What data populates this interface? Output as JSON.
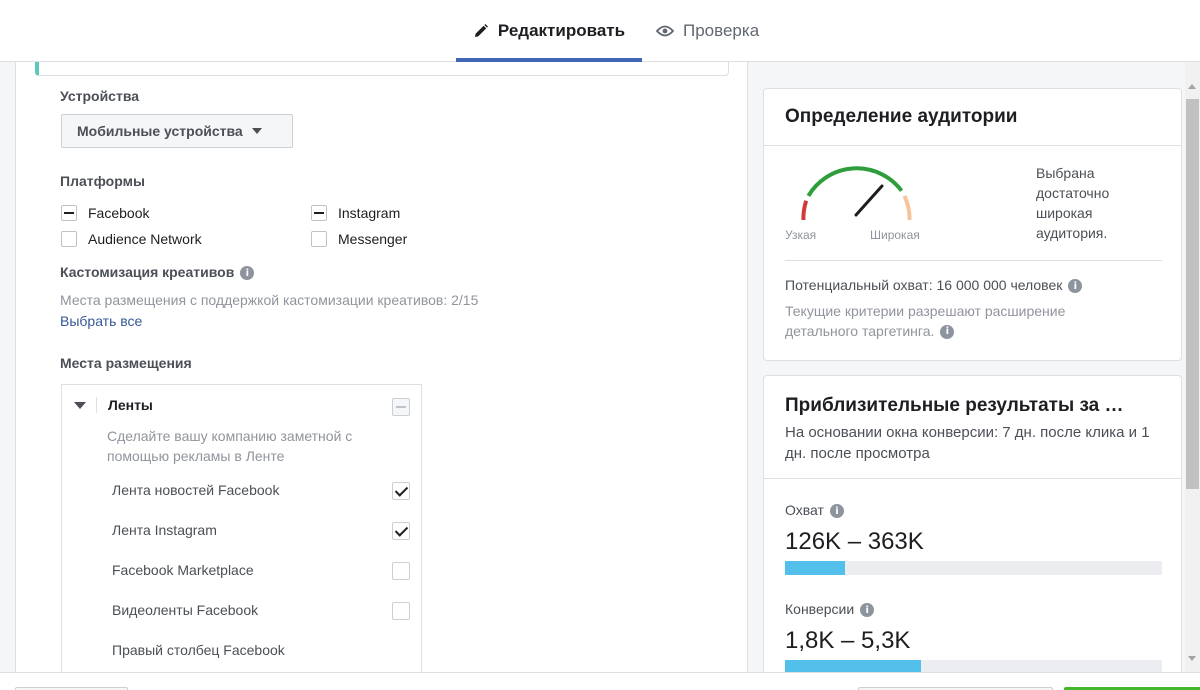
{
  "tabs": {
    "edit": "Редактировать",
    "review": "Проверка"
  },
  "devices": {
    "label": "Устройства",
    "selected": "Мобильные устройства"
  },
  "platforms": {
    "label": "Платформы",
    "items": [
      {
        "label": "Facebook",
        "state": "indeterminate"
      },
      {
        "label": "Instagram",
        "state": "indeterminate"
      },
      {
        "label": "Audience Network",
        "state": "unchecked"
      },
      {
        "label": "Messenger",
        "state": "unchecked"
      }
    ]
  },
  "customization": {
    "label": "Кастомизация креативов",
    "support_text": "Места размещения с поддержкой кастомизации креативов: 2/15",
    "select_all": "Выбрать все"
  },
  "placements": {
    "label": "Места размещения",
    "group_title": "Ленты",
    "group_desc": "Сделайте вашу компанию заметной с помощью рекламы в Ленте",
    "items": [
      {
        "label": "Лента новостей Facebook",
        "checked": true
      },
      {
        "label": "Лента Instagram",
        "checked": true
      },
      {
        "label": "Facebook Marketplace",
        "checked": false
      },
      {
        "label": "Видеоленты Facebook",
        "checked": false
      },
      {
        "label": "Правый столбец Facebook",
        "checked": false
      }
    ]
  },
  "audience": {
    "title": "Определение аудитории",
    "gauge_narrow": "Узкая",
    "gauge_wide": "Широкая",
    "status_text": "Выбрана достаточно широкая аудитория.",
    "potential_reach": "Потенциальный охват: 16 000 000 человек",
    "criteria_text": "Текущие критерии разрешают расширение детального таргетинга."
  },
  "results": {
    "title": "Приблизительные результаты за …",
    "subtitle": "На основании окна конверсии: 7 дн. после клика и 1 дн. после просмотра",
    "reach_label": "Охват",
    "reach_value": "126K – 363K",
    "reach_fill_fraction": 0.16,
    "conversions_label": "Конверсии",
    "conversions_value": "1,8K – 5,3K",
    "conversions_fill_fraction": 0.36
  },
  "colors": {
    "accent": "#4267b2",
    "bar_fill": "#52c0ea",
    "gauge_green": "#2d9e3b",
    "gauge_red": "#d23b3b",
    "gauge_peach": "#f7c39a",
    "link": "#365899"
  }
}
